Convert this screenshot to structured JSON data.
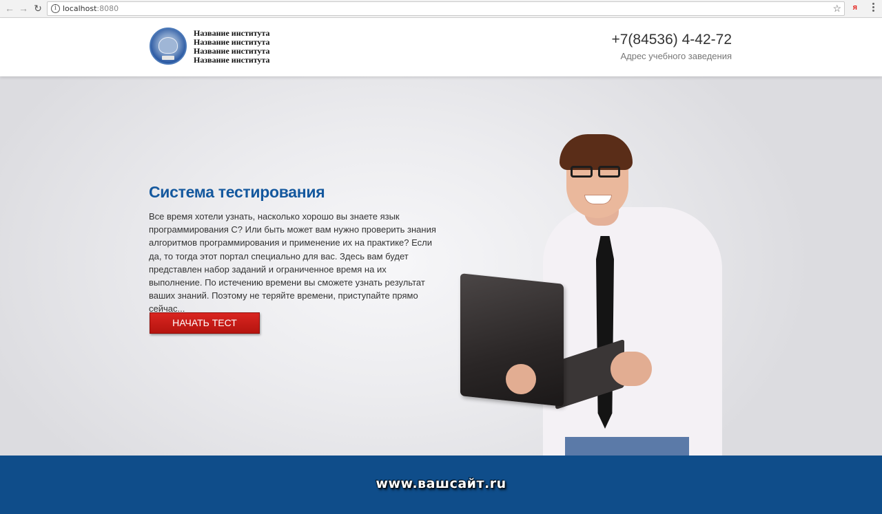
{
  "browser": {
    "url_host": "localhost",
    "url_port": ":8080",
    "back_icon": "←",
    "forward_icon": "→",
    "reload_icon": "↻",
    "info_icon": "i",
    "star_icon": "☆",
    "ya_icon": "я"
  },
  "header": {
    "institute_lines": [
      "Название института",
      "Название института",
      "Название института",
      "Название института"
    ],
    "phone": "+7(84536) 4-42-72",
    "address": "Адрес учебного заведения"
  },
  "hero": {
    "title": "Система тестирования",
    "text": "Все время хотели узнать, насколько хорошо вы знаете язык программирования С? Или быть может вам нужно проверить знания алгоритмов программирования и применение их на практике? Если да, то тогда этот портал специально для вас. Здесь вам будет представлен набор заданий и ограниченное время на их выполнение. По истечению времени вы сможете узнать результат ваших знаний. Поэтому не теряйте времени, приступайте прямо сейчас...",
    "button_label": "НАЧАТЬ ТЕСТ"
  },
  "footer": {
    "site": "www.вашсайт.ru"
  },
  "colors": {
    "title_blue": "#14589e",
    "button_red": "#c81b16",
    "footer_blue": "#0f4d8a"
  }
}
